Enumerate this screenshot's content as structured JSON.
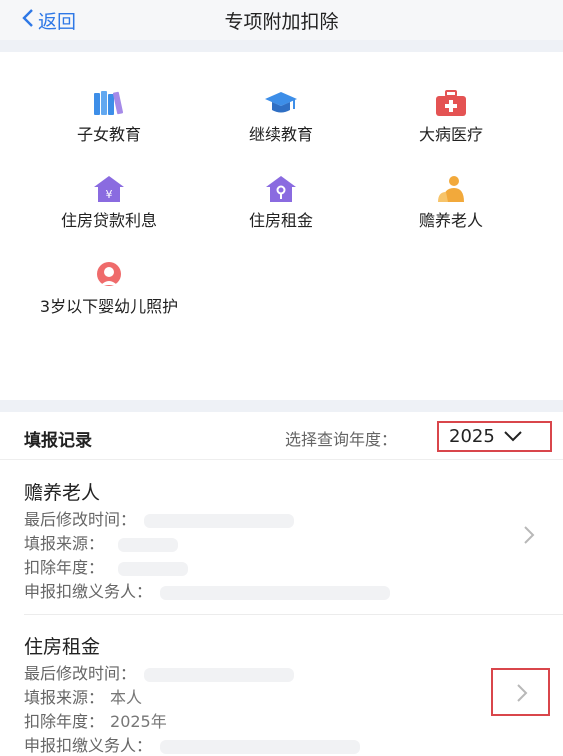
{
  "nav": {
    "back_label": "返回",
    "title": "专项附加扣除"
  },
  "categories": [
    {
      "label": "子女教育",
      "icon": "books-icon"
    },
    {
      "label": "继续教育",
      "icon": "graduation-cap-icon"
    },
    {
      "label": "大病医疗",
      "icon": "medical-kit-icon"
    },
    {
      "label": "住房贷款利息",
      "icon": "house-loan-icon"
    },
    {
      "label": "住房租金",
      "icon": "house-rent-icon"
    },
    {
      "label": "赡养老人",
      "icon": "elderly-icon"
    },
    {
      "label": "3岁以下婴幼儿照护",
      "icon": "infant-care-icon"
    }
  ],
  "records": {
    "title": "填报记录",
    "year_label": "选择查询年度：",
    "year_value": "2025",
    "field_labels": {
      "modified": "最后修改时间：",
      "source": "填报来源：",
      "year": "扣除年度：",
      "obligor": "申报扣缴义务人："
    },
    "items": [
      {
        "name": "赡养老人",
        "source": "",
        "year": ""
      },
      {
        "name": "住房租金",
        "source": "本人",
        "year": "2025年"
      }
    ]
  },
  "colors": {
    "accent": "#2e78e6",
    "highlight": "#d9464b"
  }
}
